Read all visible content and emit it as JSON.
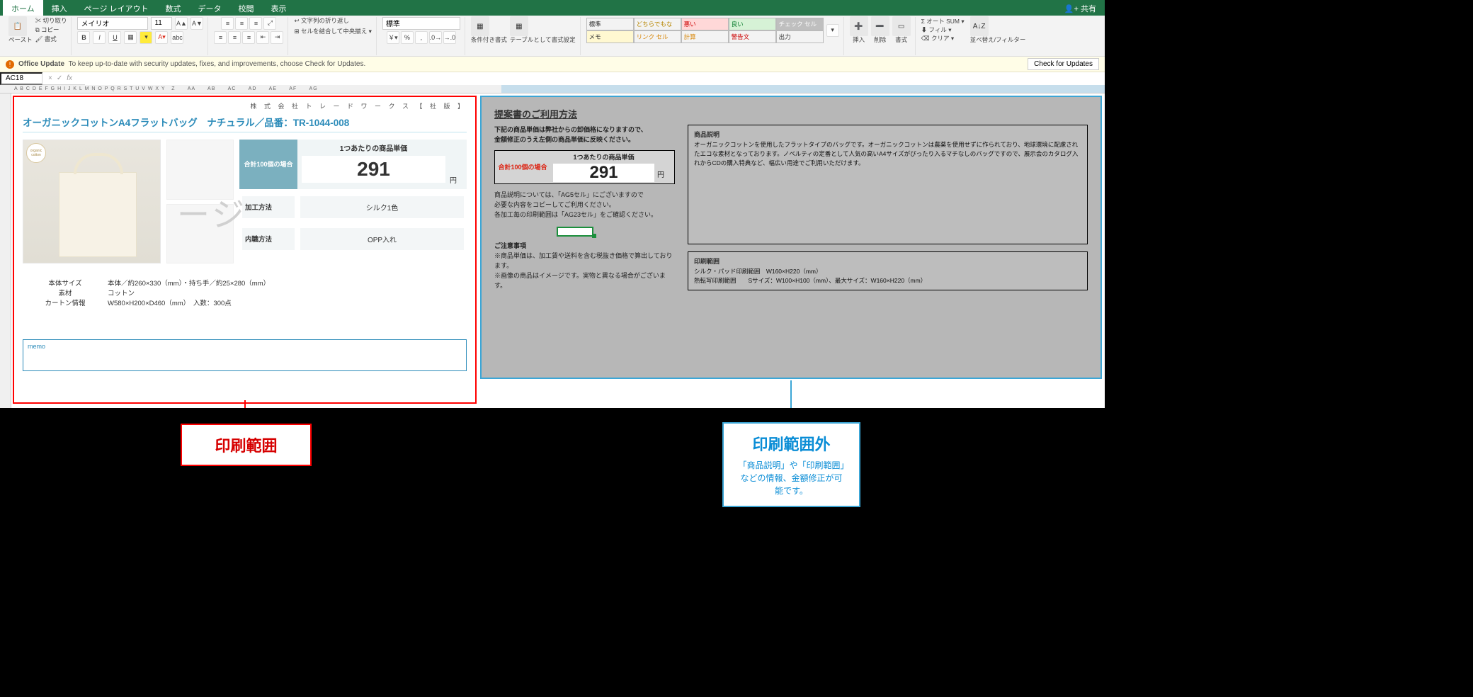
{
  "share_label": "共有",
  "tabs": [
    "ホーム",
    "挿入",
    "ページ レイアウト",
    "数式",
    "データ",
    "校閲",
    "表示"
  ],
  "clipboard": {
    "paste": "ペースト",
    "cut": "切り取り",
    "copy": "コピー",
    "format": "書式"
  },
  "font": {
    "name": "メイリオ",
    "size": "11",
    "bold": "B",
    "italic": "I",
    "underline": "U"
  },
  "align": {
    "wrap": "文字列の折り返し",
    "merge": "セルを結合して中央揃え"
  },
  "number": {
    "style": "標準"
  },
  "tables": {
    "cond": "条件付き書式",
    "tbl": "テーブルとして書式設定"
  },
  "styles": {
    "r1": [
      "標準",
      "どちらでもない",
      "悪い",
      "良い",
      "チェック セル"
    ],
    "r2": [
      "メモ",
      "リンク セル",
      "計算",
      "警告文",
      "出力"
    ]
  },
  "cells": {
    "insert": "挿入",
    "delete": "削除",
    "format": "書式"
  },
  "editing": {
    "autosum": "オート SUM",
    "fill": "フィル",
    "clear": "クリア",
    "sort": "並べ替え/フィルター"
  },
  "notice": {
    "title": "Office Update",
    "text": "To keep up-to-date with security updates, fixes, and improvements, choose Check for Updates.",
    "btn": "Check for Updates"
  },
  "namebox": "AC18",
  "fx_placeholder": "",
  "columns": [
    "A",
    "B",
    "C",
    "D",
    "E",
    "F",
    "G",
    "H",
    "I",
    "J",
    "K",
    "L",
    "M",
    "N",
    "O",
    "P",
    "Q",
    "R",
    "S",
    "T",
    "U",
    "V",
    "W",
    "X",
    "Y"
  ],
  "company": "株 式 会 社 ト レ ー ド ワ ー ク ス 【 社 版 】",
  "product_title": "オーガニックコットンA4フラットバッグ　ナチュラル／品番：TR-1044-008",
  "price": {
    "group_label": "合計100個の場合",
    "unit_label": "1つあたりの商品単価",
    "value": "291",
    "yen": "円",
    "spec1k": "加工方法",
    "spec1v": "シルク1色",
    "spec2k": "内職方法",
    "spec2v": "OPP入れ"
  },
  "meta": {
    "k1": "本体サイズ",
    "v1": "本体／約260×330（mm）・持ち手／約25×280（mm）",
    "k2": "素材",
    "v2": "コットン",
    "k3": "カートン情報",
    "v3": "W580×H200×D460（mm）　入数：300点"
  },
  "memo_label": "memo",
  "guide": {
    "title": "提案書のご利用方法",
    "l1": "下記の商品単価は弊社からの卸価格になりますので、",
    "l2": "金額修正のうえ左側の商品単価に反映ください。",
    "gp_left": "合計100個の場合",
    "e1": "商品説明については、「AG5セル」にございますので",
    "e2": "必要な内容をコピーしてご利用ください。",
    "e3": "各加工毎の印刷範囲は「AG23セル」をご確認ください。",
    "n_hd": "ご注意事項",
    "n1": "※商品単価は、加工賃や送料を含む税抜き価格で算出しております。",
    "n2": "※画像の商品はイメージです。実物と異なる場合がございます。",
    "desc_hd": "商品説明",
    "desc_txt": "オーガニックコットンを使用したフラットタイプのバッグです。オーガニックコットンは農薬を使用せずに作られており、地球環境に配慮されたエコな素材となっております。ノベルティの定番として人気の高いA4サイズがぴったり入るマチなしのバッグですので、展示会のカタログ入れからCDの購入特典など、幅広い用途でご利用いただけます。",
    "pr_hd": "印刷範囲",
    "pr1": "シルク・パッド印刷範囲　W160×H220（mm）",
    "pr2": "熱転写印刷範囲　　Sサイズ：W100×H100（mm）、最大サイズ：W160×H220（mm）"
  },
  "callout_red": "印刷範囲",
  "callout_blue": {
    "h": "印刷範囲外",
    "d": "「商品説明」や「印刷範囲」などの情報、金額修正が可能です。"
  },
  "watermark": "ージ"
}
